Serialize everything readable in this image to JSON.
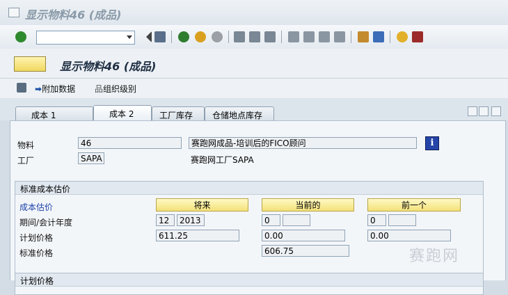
{
  "window": {
    "title": "显示物料46 (成品)"
  },
  "toolbar": {
    "command_value": ""
  },
  "app": {
    "title": "显示物料46 (成品)",
    "toolbar_items": [
      "附加数据",
      "组织级别"
    ]
  },
  "tabs": [
    {
      "label": "成本 1",
      "active": false
    },
    {
      "label": "成本 2",
      "active": true
    },
    {
      "label": "工厂库存",
      "active": false
    },
    {
      "label": "仓储地点库存",
      "active": false
    }
  ],
  "header": {
    "material_label": "物料",
    "material_value": "46",
    "material_desc": "赛跑网成品-培训后的FICO顾问",
    "plant_label": "工厂",
    "plant_value": "SAPA",
    "plant_desc": "赛跑网工厂SAPA",
    "info_glyph": "i"
  },
  "std_cost": {
    "group_title": "标准成本估价",
    "estimate_label": "成本估价",
    "columns": [
      "将来",
      "当前的",
      "前一个"
    ],
    "period_label": "期间/会计年度",
    "future_period": "12",
    "future_year": "2013",
    "current_period": "0",
    "current_year": "",
    "prev_period": "0",
    "prev_year": "",
    "planned_label": "计划价格",
    "planned_future": "611.25",
    "planned_current": "0.00",
    "planned_prev": "0.00",
    "std_label": "标准价格",
    "std_current": "606.75"
  },
  "lower_group": {
    "title": "计划价格"
  },
  "watermark": "赛跑网"
}
